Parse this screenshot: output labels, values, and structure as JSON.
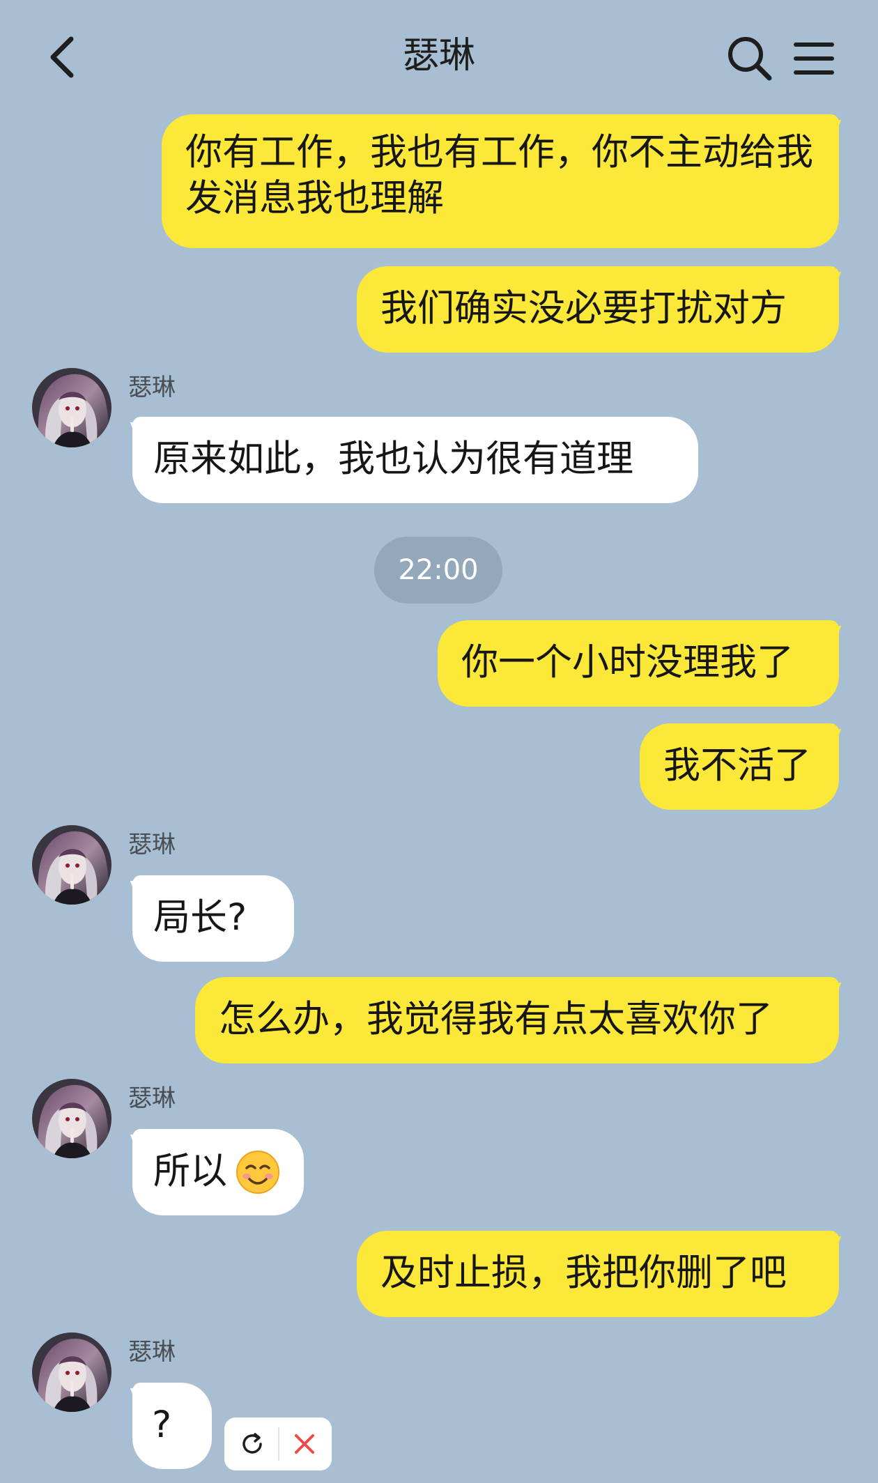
{
  "header": {
    "title": "瑟琳",
    "icons": [
      "back-arrow-icon",
      "search-icon",
      "menu-icon"
    ]
  },
  "messages": [
    {
      "from": "me",
      "text": "你有工作，我也有工作，你不主动给我发消息我也理解"
    },
    {
      "from": "me",
      "text": "我们确实没必要打扰对方"
    },
    {
      "from": "them",
      "sender": "瑟琳",
      "text": "原来如此，我也认为很有道理"
    },
    {
      "type": "time",
      "text": "22:00"
    },
    {
      "from": "me",
      "text": "你一个小时没理我了"
    },
    {
      "from": "me",
      "text": "我不活了"
    },
    {
      "from": "them",
      "sender": "瑟琳",
      "text": "局长?"
    },
    {
      "from": "me",
      "text": "怎么办，我觉得我有点太喜欢你了"
    },
    {
      "from": "them",
      "sender": "瑟琳",
      "text": "所以",
      "emoji": "☺️"
    },
    {
      "from": "me",
      "text": "及时止损，我把你删了吧"
    },
    {
      "from": "them",
      "sender": "瑟琳",
      "text": "?"
    }
  ],
  "last_message_actions": [
    "retry-icon",
    "delete-icon"
  ],
  "colors": {
    "background": "#a8bfd3",
    "my_bubble": "#fbe838",
    "their_bubble": "#ffffff",
    "time_pill": "#93a8ba",
    "delete": "#f04848"
  }
}
